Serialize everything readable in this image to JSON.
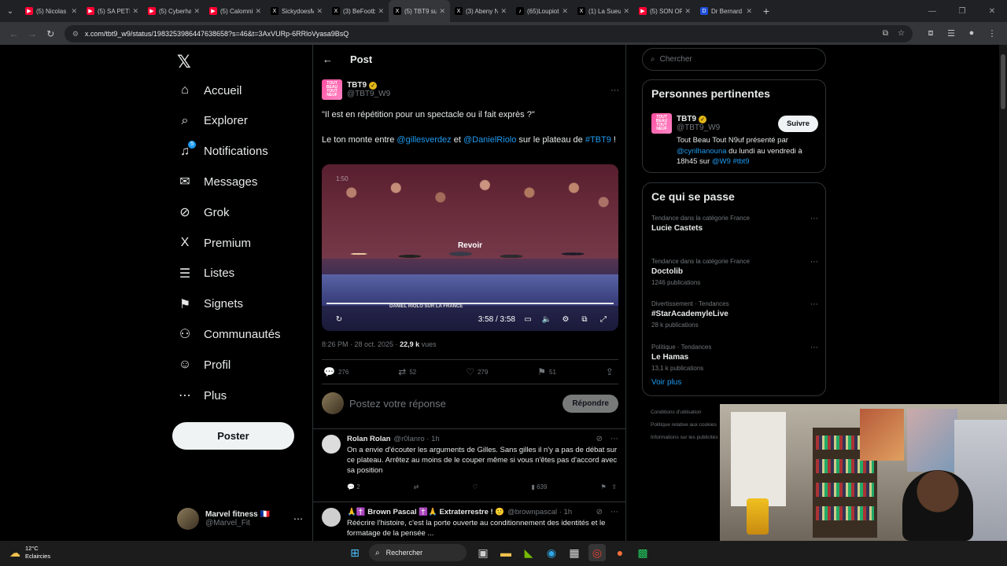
{
  "browser": {
    "tabs": [
      {
        "title": "(5) Nicolas S",
        "fav_color": "#ff0033",
        "fav_glyph": "▶",
        "active": false
      },
      {
        "title": "(5) SA PETITE",
        "fav_color": "#ff0033",
        "fav_glyph": "▶",
        "active": false
      },
      {
        "title": "(5) Cyberhar",
        "fav_color": "#ff0033",
        "fav_glyph": "▶",
        "active": false
      },
      {
        "title": "(5) Calomnie",
        "fav_color": "#ff0033",
        "fav_glyph": "▶",
        "active": false
      },
      {
        "title": "SickydoesMi",
        "fav_color": "#000000",
        "fav_glyph": "X",
        "active": false
      },
      {
        "title": "(3) BeFootba",
        "fav_color": "#000000",
        "fav_glyph": "X",
        "active": false
      },
      {
        "title": "(5) TBT9 sur",
        "fav_color": "#000000",
        "fav_glyph": "X",
        "active": true
      },
      {
        "title": "(3) Abeny N",
        "fav_color": "#000000",
        "fav_glyph": "X",
        "active": false
      },
      {
        "title": "(65)Loupiot",
        "fav_color": "#000000",
        "fav_glyph": "♪",
        "active": false
      },
      {
        "title": "(1) La Sueur",
        "fav_color": "#000000",
        "fav_glyph": "X",
        "active": false
      },
      {
        "title": "(5) SON OP",
        "fav_color": "#ff0033",
        "fav_glyph": "▶",
        "active": false
      },
      {
        "title": "Dr Bernard",
        "fav_color": "#1d4ed8",
        "fav_glyph": "D",
        "active": false
      }
    ],
    "url": "x.com/tbt9_w9/status/1983253986447638658?s=46&t=3AxVURp-6RRloVyasa9BsQ"
  },
  "nav": {
    "items": [
      {
        "label": "Accueil",
        "icon": "home-icon",
        "glyph": "⌂"
      },
      {
        "label": "Explorer",
        "icon": "search-icon",
        "glyph": "⌕"
      },
      {
        "label": "Notifications",
        "icon": "bell-icon",
        "glyph": "♫"
      },
      {
        "label": "Messages",
        "icon": "mail-icon",
        "glyph": "✉"
      },
      {
        "label": "Grok",
        "icon": "grok-icon",
        "glyph": "⊘"
      },
      {
        "label": "Premium",
        "icon": "x-logo-icon",
        "glyph": "X"
      },
      {
        "label": "Listes",
        "icon": "list-icon",
        "glyph": "☰"
      },
      {
        "label": "Signets",
        "icon": "bookmark-icon",
        "glyph": "⚑"
      },
      {
        "label": "Communautés",
        "icon": "community-icon",
        "glyph": "⚇"
      },
      {
        "label": "Profil",
        "icon": "profile-icon",
        "glyph": "☺"
      },
      {
        "label": "Plus",
        "icon": "more-circle-icon",
        "glyph": "⋯"
      }
    ],
    "notifications_badge": "5",
    "post_button": "Poster",
    "account": {
      "name": "Marvel fitness 🇫🇷",
      "handle": "@Marvel_Fit"
    }
  },
  "post": {
    "header": "Post",
    "author_name": "TBT9",
    "author_handle": "@TBT9_W9",
    "logo_text": "TOUT BEAU TOUT NEUF",
    "text_quote": "\"Il est en répétition pour un spectacle ou il fait exprès ?\"",
    "text_intro": "Le ton monte entre ",
    "mention1": "@gillesverdez",
    "text_mid": " et ",
    "mention2": "@DanielRiolo",
    "text_after": " sur le plateau de ",
    "hashtag": "#TBT9",
    "text_end": " !",
    "video": {
      "corner_time": "1:50",
      "replay_label": "Revoir",
      "time": "3:58 / 3:58",
      "banner": "DANIEL RIOLO SUR LA FRANCE",
      "progress": 1.0
    },
    "meta_time": "8:26 PM · 28 oct. 2025 · ",
    "views_count": "22,9 k",
    "views_label": " vues",
    "stats": {
      "replies": "276",
      "reposts": "52",
      "likes": "279",
      "bookmarks": "51"
    },
    "reply_placeholder": "Postez votre réponse",
    "reply_button": "Répondre"
  },
  "replies": [
    {
      "name": "Rolan Rolan",
      "handle": "@r0lanro · 1h",
      "text": "On a envie d'écouter les arguments de Gilles. Sans gilles il n'y a pas de débat sur ce plateau. Arrêtez au moins de le couper même si vous n'êtes pas d'accord avec sa position",
      "replies": "2",
      "views": "639"
    },
    {
      "name": "🙏✝️ Brown Pascal ✝️🙏 Extraterrestre ! 🙂",
      "handle": "@brownpascal · 1h",
      "text": "Réécrire l'histoire, c'est la porte ouverte au conditionnement des identités et le formatage de la pensée ..."
    }
  ],
  "right": {
    "search_placeholder": "Chercher",
    "related_title": "Personnes pertinentes",
    "related": {
      "name": "TBT9",
      "handle": "@TBT9_W9",
      "follow": "Suivre",
      "bio_a": "Tout Beau Tout N9uf présenté par ",
      "bio_link1": "@cyrilhanouna",
      "bio_b": " du lundi au vendredi à 18h45 sur ",
      "bio_link2": "@W9",
      "bio_c": " ",
      "bio_link3": "#tbt9"
    },
    "trends_title": "Ce qui se passe",
    "trends": [
      {
        "category": "Tendance dans la catégorie France",
        "title": "Lucie Castets",
        "count": ""
      },
      {
        "category": "Tendance dans la catégorie France",
        "title": "Doctolib",
        "count": "1246 publications"
      },
      {
        "category": "Divertissement · Tendances",
        "title": "#StarAcademyleLive",
        "count": "28 k publications"
      },
      {
        "category": "Politique · Tendances",
        "title": "Le Hamas",
        "count": "13,1 k publications"
      }
    ],
    "see_more": "Voir plus",
    "footer": [
      "Conditions d'utilisation",
      "Politique relative aux cookies",
      "Informations sur les publicités"
    ]
  },
  "taskbar": {
    "temp": "12°C",
    "weather": "Eclaircies",
    "search": "Rechercher"
  },
  "colors": {
    "accent": "#1d9bf0",
    "bg": "#000000",
    "verified_gold": "#e2b719"
  }
}
